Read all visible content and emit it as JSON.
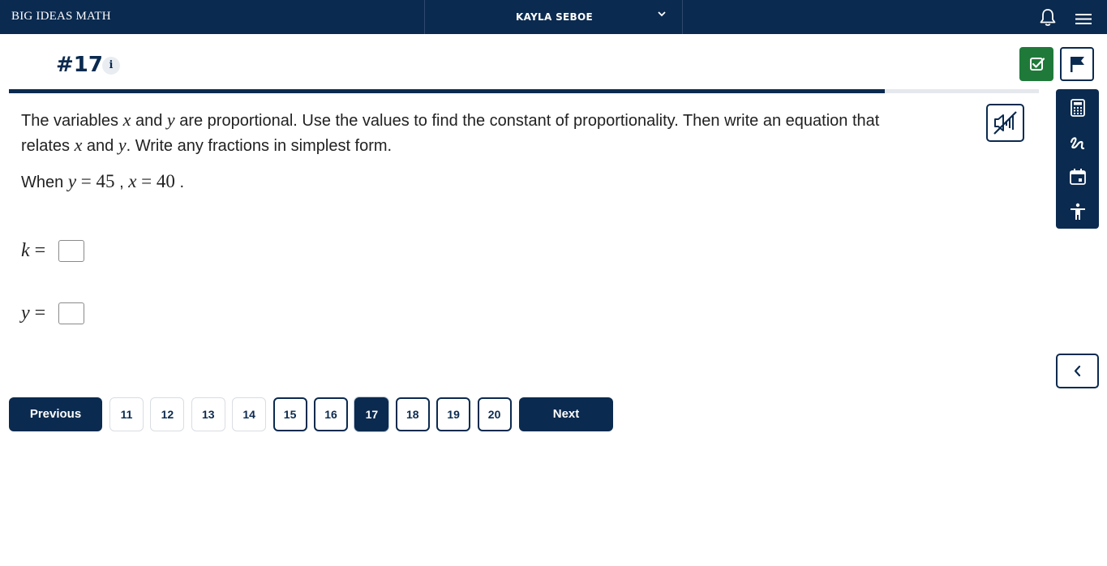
{
  "header": {
    "brand": "BIG IDEAS MATH",
    "user_name": "KAYLA SEBOE"
  },
  "question": {
    "number_label": "#17",
    "info_label": "i",
    "progress_fraction": 0.85,
    "prompt_part1": "The variables ",
    "var_x": "x",
    "and1": " and ",
    "var_y": "y",
    "prompt_part2": " are proportional. Use the values to find the constant of proportionality. Then write an equation that relates ",
    "var_x2": "x",
    "and2": " and ",
    "var_y2": "y",
    "prompt_part3": ". Write any fractions in simplest form.",
    "when_label": "When ",
    "cond_y_var": "y",
    "cond_y_eq": " = 45",
    "cond_sep": " ,  ",
    "cond_x_var": "x",
    "cond_x_eq": " = 40",
    "cond_end": " .",
    "answers": [
      {
        "var": "k",
        "eq": " ="
      },
      {
        "var": "y",
        "eq": " ="
      }
    ]
  },
  "pager": {
    "previous_label": "Previous",
    "next_label": "Next",
    "pages": [
      {
        "label": "11",
        "state": "visited"
      },
      {
        "label": "12",
        "state": "visited"
      },
      {
        "label": "13",
        "state": "visited"
      },
      {
        "label": "14",
        "state": "visited"
      },
      {
        "label": "15",
        "state": "unvisited"
      },
      {
        "label": "16",
        "state": "unvisited"
      },
      {
        "label": "17",
        "state": "current"
      },
      {
        "label": "18",
        "state": "unvisited"
      },
      {
        "label": "19",
        "state": "unvisited"
      },
      {
        "label": "20",
        "state": "unvisited"
      }
    ]
  },
  "icons": {
    "user_menu": "chevron-down-icon",
    "notifications": "bell-icon",
    "menu": "hamburger-icon",
    "submit": "check-square-icon",
    "flag": "flag-icon",
    "audio": "audio-muted-icon",
    "tools": [
      "calculator-icon",
      "sketch-icon",
      "calendar-icon",
      "accessibility-icon"
    ],
    "collapse": "chevron-left-icon"
  },
  "colors": {
    "navy": "#0b2a4f",
    "green": "#1f7a3a"
  }
}
